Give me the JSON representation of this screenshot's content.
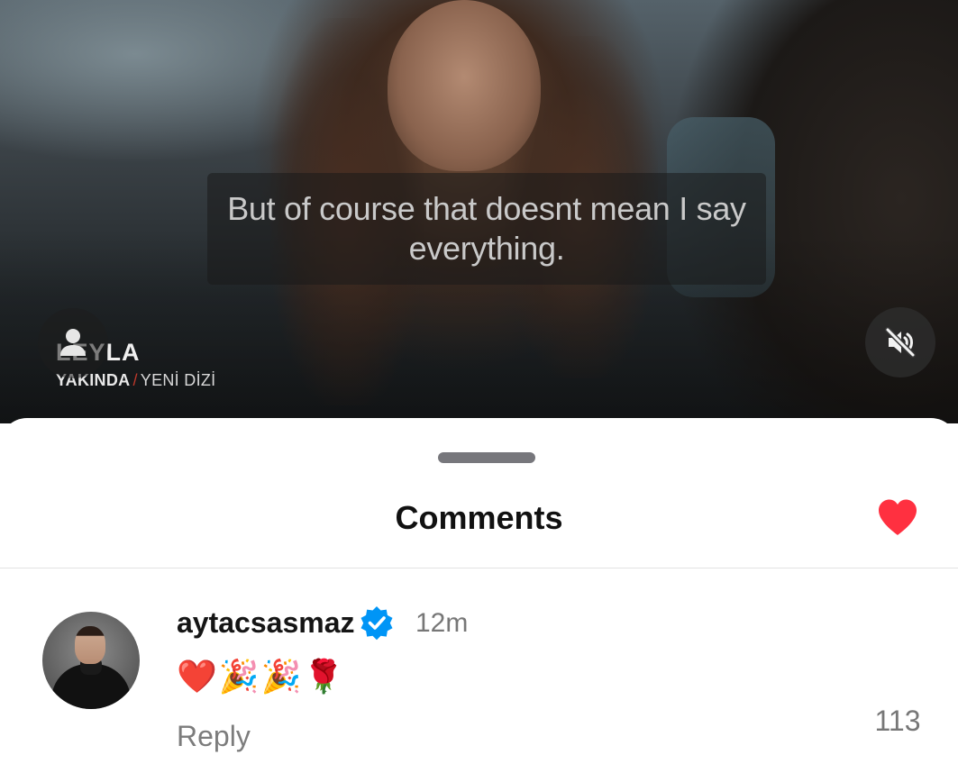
{
  "video": {
    "subtitle": "But of course that doesnt mean I say everything.",
    "watermark_title": "LEYLA",
    "watermark_word1": "YAKINDA",
    "watermark_sep": "/",
    "watermark_word2": "YENİ DİZİ",
    "mute_icon": "volume-muted-icon",
    "profile_icon": "person-icon"
  },
  "comments_sheet": {
    "title": "Comments",
    "comments": [
      {
        "username": "aytacsasmaz",
        "verified": true,
        "time": "12m",
        "text": "❤️🎉🎉🌹",
        "reply_label": "Reply",
        "like_count": "113",
        "liked": true
      }
    ]
  },
  "colors": {
    "like_red": "#ff3040",
    "verified_blue": "#0095f6",
    "sheet_bg": "#ffffff"
  }
}
